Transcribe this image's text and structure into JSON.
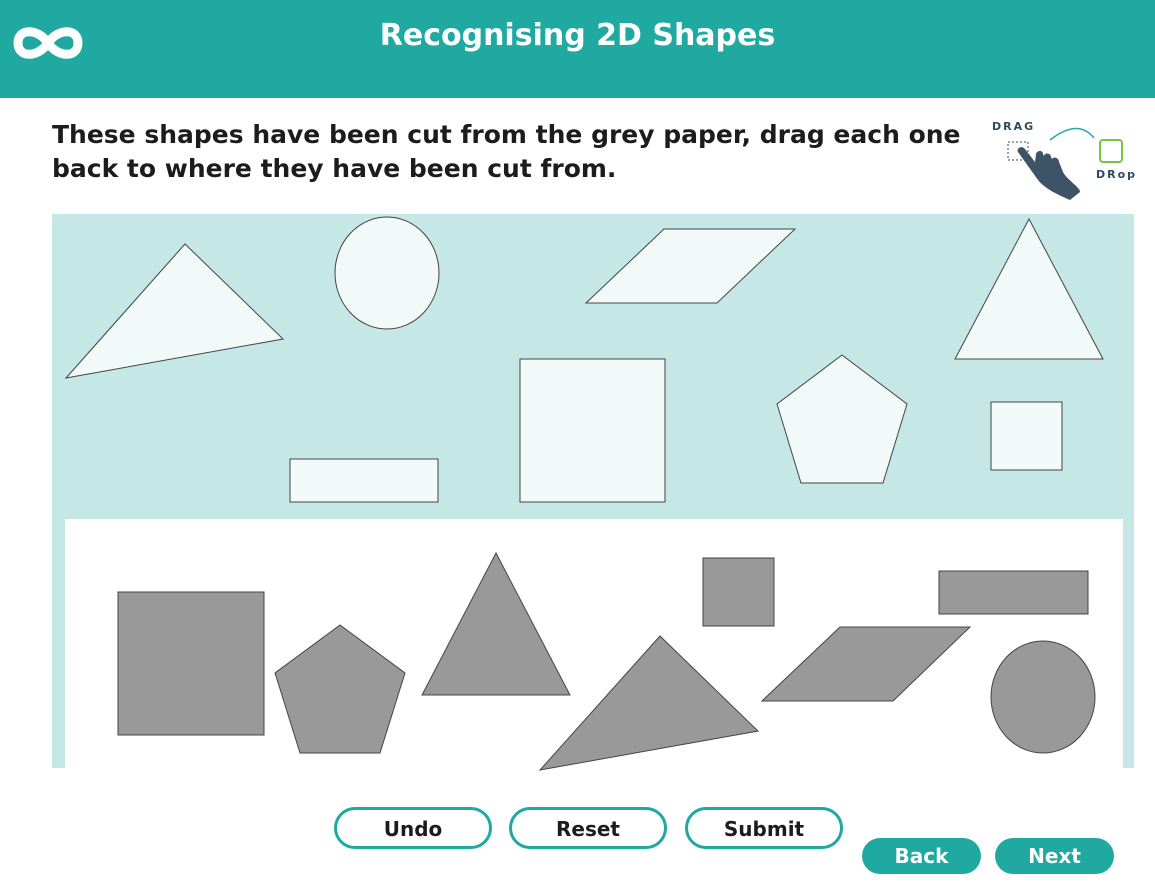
{
  "header": {
    "title": "Recognising 2D Shapes",
    "logo_icon": "infinity-icon",
    "color": "#1fa9a1"
  },
  "instructions": "These shapes have been cut from the grey paper, drag each one back to where they have been cut from.",
  "drag_drop_icon": {
    "drag_label": "DRAG",
    "drop_label": "DRop",
    "icon": "hand-pointer-icon"
  },
  "draggable_shapes": [
    "scalene-triangle",
    "circle",
    "parallelogram",
    "isosceles-triangle",
    "rectangle",
    "square-large",
    "pentagon",
    "square-small"
  ],
  "cutout_holes": [
    "square-large",
    "pentagon",
    "isosceles-triangle",
    "square-small",
    "rectangle",
    "scalene-triangle",
    "parallelogram",
    "circle"
  ],
  "buttons": {
    "undo": "Undo",
    "reset": "Reset",
    "submit": "Submit",
    "back": "Back",
    "next": "Next"
  },
  "colors": {
    "accent": "#1fa9a1",
    "stage": "#c5e7e6",
    "shape_fill": "#f1f9f9",
    "hole_fill": "#999999"
  }
}
